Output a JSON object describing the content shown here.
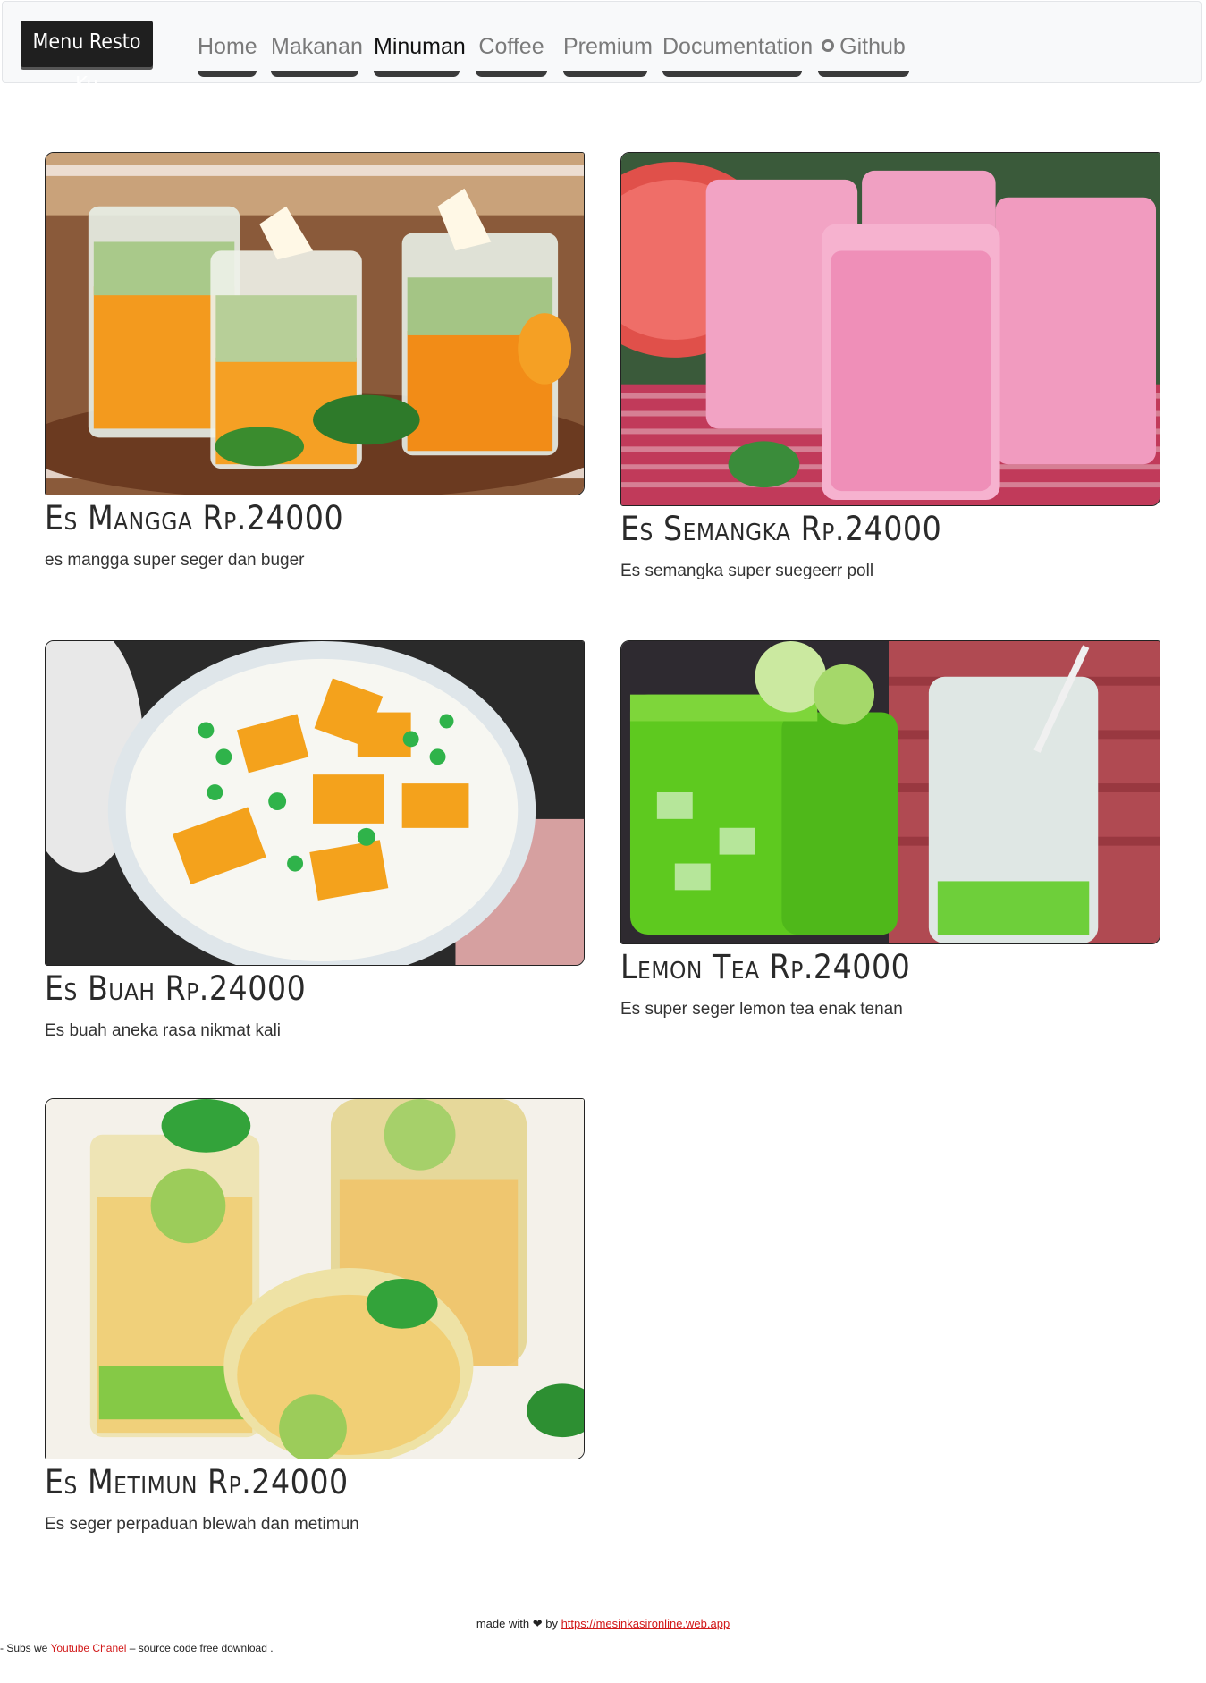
{
  "navbar": {
    "brand": "Menu Resto Ku",
    "items": [
      {
        "label": "Home"
      },
      {
        "label": "Makanan"
      },
      {
        "label": "Minuman"
      },
      {
        "label": "Coffee"
      },
      {
        "label": "Premium"
      },
      {
        "label": "Documentation"
      },
      {
        "label": "Github"
      }
    ]
  },
  "cards": [
    {
      "title": "Es Mangga Rp.24000",
      "desc": "es mangga super seger dan buger"
    },
    {
      "title": "Es Semangka Rp.24000",
      "desc": "Es semangka super suegeerr poll"
    },
    {
      "title": "Es Buah Rp.24000",
      "desc": "Es buah aneka rasa nikmat kali"
    },
    {
      "title": "Lemon Tea Rp.24000",
      "desc": "Es super seger lemon tea enak tenan"
    },
    {
      "title": "Es Metimun Rp.24000",
      "desc": "Es seger perpaduan blewah dan metimun"
    }
  ],
  "footer": {
    "made_with": "made with",
    "heart": "❤",
    "by": "by",
    "link": "https://mesinkasironline.web.app"
  },
  "subs": {
    "prefix": "- Subs we",
    "link": "Youtube Chanel",
    "suffix": "– source code free download ."
  }
}
